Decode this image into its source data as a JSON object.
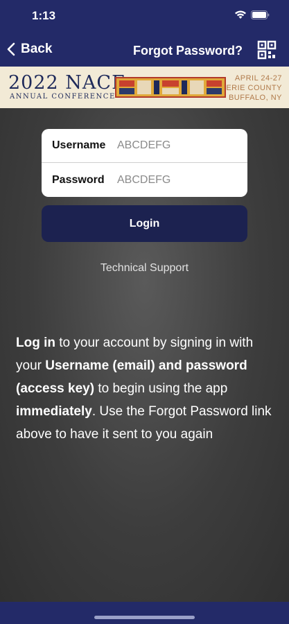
{
  "status_bar": {
    "time": "1:13",
    "icons": [
      "wifi-icon",
      "battery-icon"
    ]
  },
  "nav": {
    "back_label": "Back",
    "forgot_label": "Forgot Password?",
    "right_icon": "qr-code-icon"
  },
  "banner": {
    "title": "2022 NACE",
    "subtitle": "ANNUAL CONFERENCE",
    "date_line1": "APRIL 24-27",
    "date_line2": "ERIE COUNTY",
    "date_line3": "BUFFALO, NY"
  },
  "login": {
    "username_label": "Username",
    "username_placeholder": "ABCDEFG",
    "password_label": "Password",
    "password_placeholder": "ABCDEFG",
    "login_button": "Login",
    "tech_support": "Technical Support"
  },
  "info": {
    "part1": "Log in",
    "part2": " to your account by signing in with your ",
    "part3": "Username (email) and password (access key)",
    "part4": " to begin using the app ",
    "part5": "immediately",
    "part6": ". Use the Forgot Password link above to have it sent to you again"
  },
  "colors": {
    "nav_bg": "#232a68",
    "login_button_bg": "#1c2250",
    "banner_bg": "#f2ead6"
  }
}
